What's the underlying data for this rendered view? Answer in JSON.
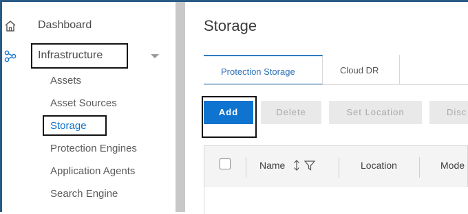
{
  "sidebar": {
    "dashboard_label": "Dashboard",
    "infrastructure_label": "Infrastructure",
    "sub_items": [
      {
        "label": "Assets"
      },
      {
        "label": "Asset Sources"
      },
      {
        "label": "Storage",
        "active": true
      },
      {
        "label": "Protection Engines"
      },
      {
        "label": "Application Agents"
      },
      {
        "label": "Search Engine"
      }
    ]
  },
  "main": {
    "title": "Storage",
    "tabs": [
      {
        "label": "Protection Storage",
        "active": true
      },
      {
        "label": "Cloud DR",
        "active": false
      }
    ],
    "toolbar": {
      "add_label": "Add",
      "delete_label": "Delete",
      "set_location_label": "Set Location",
      "disc_label": "Disc"
    },
    "table": {
      "columns": [
        {
          "label": "Name"
        },
        {
          "label": "Location"
        },
        {
          "label": "Mode"
        }
      ]
    }
  },
  "colors": {
    "accent": "#0f74cf",
    "active_text": "#0a72c9",
    "frame": "#2a5b86",
    "splitter": "#c8c8c8"
  },
  "icons": {
    "dashboard": "home-icon",
    "infrastructure": "network-nodes-icon",
    "sort": "sort-updown-icon",
    "filter": "filter-icon"
  }
}
